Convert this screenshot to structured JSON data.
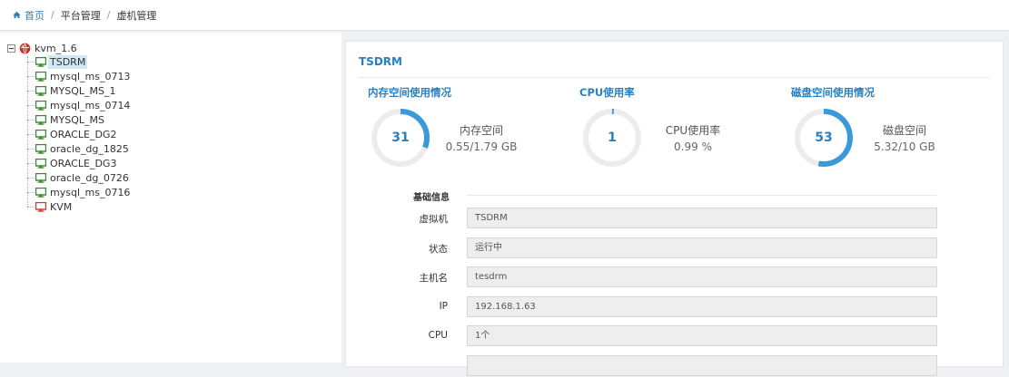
{
  "breadcrumb": {
    "home_icon": "home-icon",
    "home": "首页",
    "items": [
      "平台管理",
      "虚机管理"
    ],
    "separator": "/"
  },
  "tree": {
    "root": {
      "label": "kvm_1.6",
      "icon": "kvm-logo-icon"
    },
    "items": [
      {
        "label": "TSDRM",
        "status": "running",
        "selected": true
      },
      {
        "label": "mysql_ms_0713",
        "status": "running"
      },
      {
        "label": "MYSQL_MS_1",
        "status": "running"
      },
      {
        "label": "mysql_ms_0714",
        "status": "running"
      },
      {
        "label": "MYSQL_MS",
        "status": "running"
      },
      {
        "label": "ORACLE_DG2",
        "status": "running"
      },
      {
        "label": "oracle_dg_1825",
        "status": "running"
      },
      {
        "label": "ORACLE_DG3",
        "status": "running"
      },
      {
        "label": "oracle_dg_0726",
        "status": "running"
      },
      {
        "label": "mysql_ms_0716",
        "status": "running"
      },
      {
        "label": "KVM",
        "status": "stopped"
      }
    ],
    "colors": {
      "running": "#2e8b2e",
      "stopped": "#d9322b"
    }
  },
  "detail": {
    "title": "TSDRM",
    "metrics": [
      {
        "title": "内存空间使用情况",
        "percent": 31,
        "label": "内存空间",
        "value": "0.55/1.79 GB"
      },
      {
        "title": "CPU使用率",
        "percent": 1,
        "label": "CPU使用率",
        "value": "0.99 %"
      },
      {
        "title": "磁盘空间使用情况",
        "percent": 53,
        "label": "磁盘空间",
        "value": "5.32/10 GB"
      }
    ],
    "colors": {
      "accent": "#2a7fc0",
      "gauge_fill": "#3a9ad9",
      "gauge_track": "#ececec"
    },
    "section_title": "基础信息",
    "fields": [
      {
        "label": "虚拟机",
        "value": "TSDRM"
      },
      {
        "label": "状态",
        "value": "运行中"
      },
      {
        "label": "主机名",
        "value": "tesdrm"
      },
      {
        "label": "IP",
        "value": "192.168.1.63"
      },
      {
        "label": "CPU",
        "value": "1个"
      }
    ]
  }
}
